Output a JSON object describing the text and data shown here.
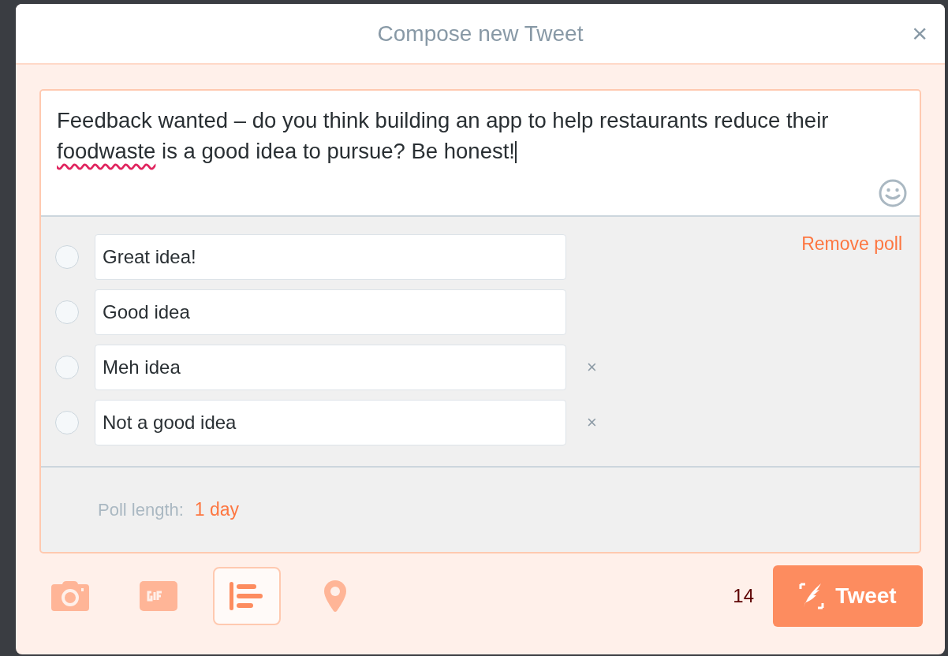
{
  "window": {
    "title": "Compose new Tweet",
    "close": "×"
  },
  "tweet": {
    "segments": [
      {
        "text": "Feedback wanted – do you think building an app to help restaurants reduce their ",
        "misspelled": false
      },
      {
        "text": "foodwaste",
        "misspelled": true
      },
      {
        "text": " is a good idea to pursue? Be honest!",
        "misspelled": false
      }
    ]
  },
  "poll": {
    "remove_label": "Remove poll",
    "choices": [
      {
        "value": "Great idea!",
        "selected": false
      },
      {
        "value": "Good idea",
        "selected": false
      },
      {
        "value": "Meh idea",
        "selected": false,
        "remove": "×"
      },
      {
        "value": "Not a good idea",
        "selected": false,
        "remove": "×"
      }
    ],
    "length_label": "Poll length:",
    "length_value": "1 day"
  },
  "toolbar": [
    {
      "kind": "photo",
      "selected": false
    },
    {
      "kind": "gif",
      "selected": false
    },
    {
      "kind": "poll",
      "selected": true
    },
    {
      "kind": "location",
      "selected": false
    }
  ],
  "char_count": "14",
  "tweet_button": "Tweet"
}
